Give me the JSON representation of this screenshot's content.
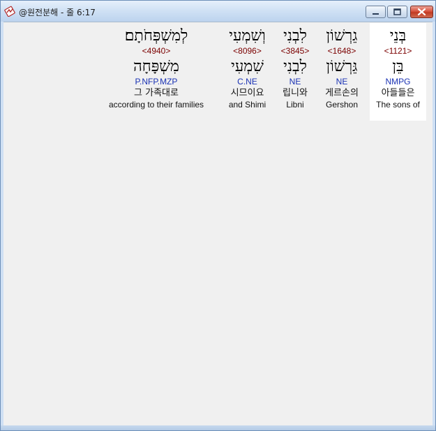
{
  "window": {
    "title": "@원전분해 - 줄 6:17"
  },
  "words": [
    {
      "hebrew": "בְּנֵי",
      "strong": "<1121>",
      "lemma": "בֵּן",
      "parse": "NMPG",
      "korean": "아들들은",
      "english": "The sons of"
    },
    {
      "hebrew": "גֵרְשׁוֹן",
      "strong": "<1648>",
      "lemma": "גֵּרְשׁוֹן",
      "parse": "NE",
      "korean": "게르손의",
      "english": "Gershon"
    },
    {
      "hebrew": "לִבְנִי",
      "strong": "<3845>",
      "lemma": "לִבְנִי",
      "parse": "NE",
      "korean": "립니와",
      "english": "Libni"
    },
    {
      "hebrew": "וְשִׁמְעִי",
      "strong": "<8096>",
      "lemma": "שִׁמְעִי",
      "parse": "C.NE",
      "korean": "시므이요",
      "english": "and Shimi"
    },
    {
      "hebrew": "לְמִשְׁפְּחֹתָם׃",
      "strong": "<4940>",
      "lemma": "מִשְׁפָּחָה",
      "parse": "P.NFP.MZP",
      "korean": "그 가족대로",
      "english": "according to their families"
    }
  ]
}
